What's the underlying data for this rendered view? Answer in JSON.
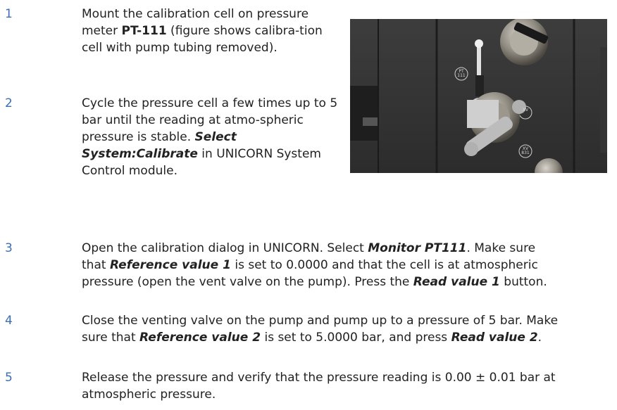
{
  "steps": [
    {
      "number": "1",
      "parts": [
        {
          "t": "Mount the calibration cell on pressure meter ",
          "s": ""
        },
        {
          "t": "PT-111",
          "s": "b"
        },
        {
          "t": " (figure shows calibra-tion cell with pump tubing removed).",
          "s": ""
        }
      ]
    },
    {
      "number": "2",
      "parts": [
        {
          "t": "Cycle the pressure cell a few times up to 5 bar until the reading at atmo-spheric pressure is stable. ",
          "s": ""
        },
        {
          "t": "Select System:Calibrate",
          "s": "bi"
        },
        {
          "t": " in UNICORN System Control module.",
          "s": ""
        }
      ]
    },
    {
      "number": "3",
      "parts": [
        {
          "t": "Open the calibration dialog in UNICORN. Select ",
          "s": ""
        },
        {
          "t": "Monitor PT111",
          "s": "bi"
        },
        {
          "t": ". Make sure that ",
          "s": ""
        },
        {
          "t": "Reference value 1",
          "s": "bi"
        },
        {
          "t": " is set to 0.0000 and that the cell is at atmospheric pressure (open the vent valve on the pump). Press the ",
          "s": ""
        },
        {
          "t": "Read value 1",
          "s": "bi"
        },
        {
          "t": " button.",
          "s": ""
        }
      ]
    },
    {
      "number": "4",
      "parts": [
        {
          "t": "Close the venting valve on the pump and pump up to a pressure of 5 bar. Make sure that ",
          "s": ""
        },
        {
          "t": "Reference value 2",
          "s": "bi"
        },
        {
          "t": " is set to 5.0000 bar, and press ",
          "s": ""
        },
        {
          "t": "Read value 2",
          "s": "bi"
        },
        {
          "t": ".",
          "s": ""
        }
      ]
    },
    {
      "number": "5",
      "parts": [
        {
          "t": "Release the pressure and verify that the pressure reading is 0.00 ± 0.01 bar at atmospheric pressure.",
          "s": ""
        }
      ]
    }
  ],
  "photo": {
    "labels": [
      "PT 111",
      "XV",
      "XV 831"
    ]
  }
}
